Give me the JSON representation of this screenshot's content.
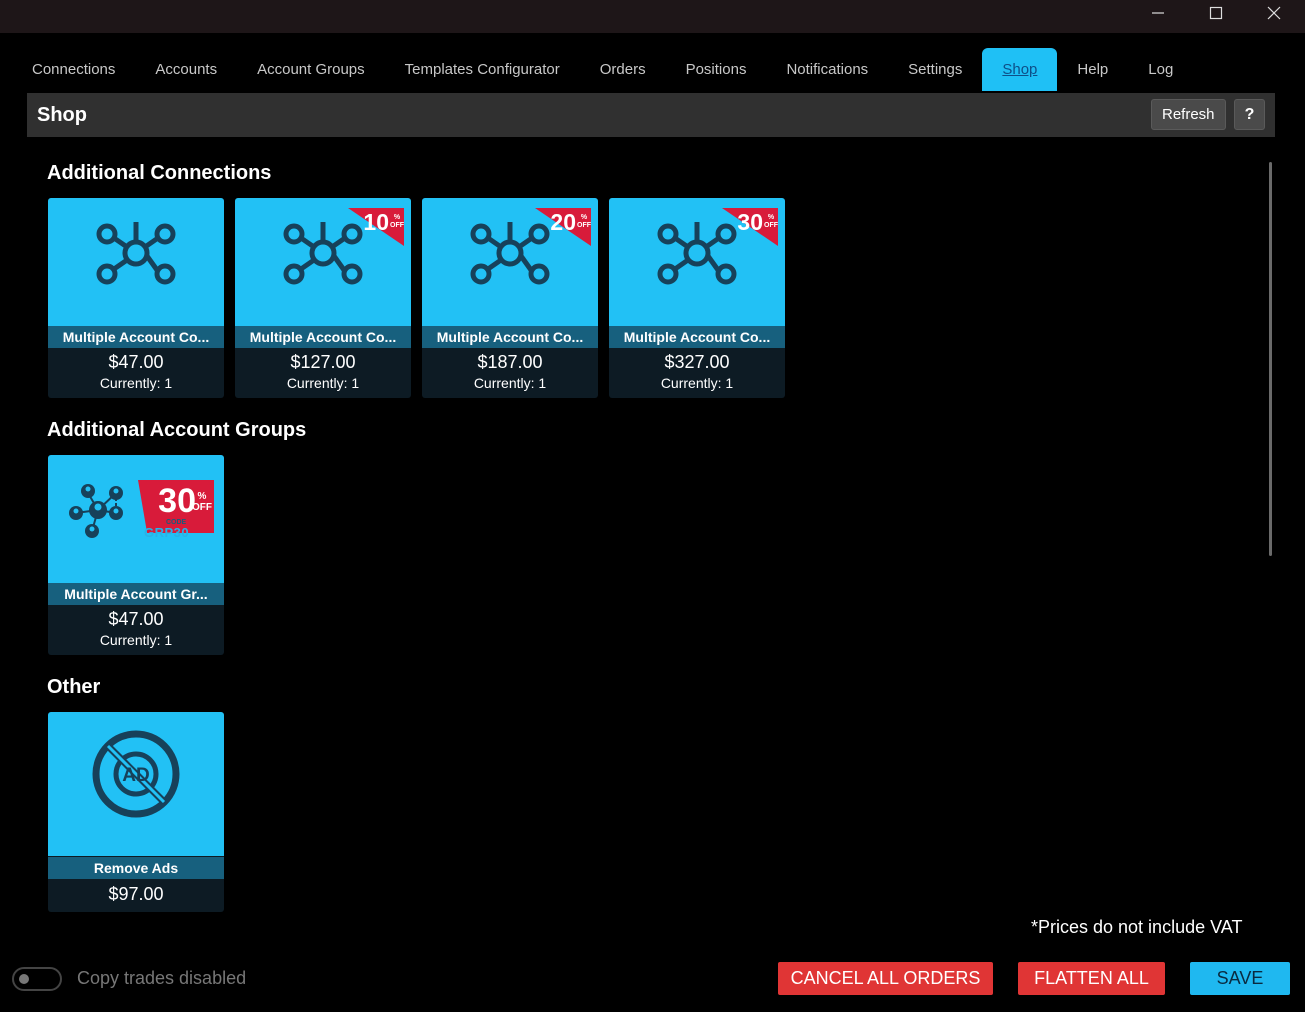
{
  "window": {
    "minimize_glyph": "—",
    "maximize_glyph": "☐",
    "close_glyph": "✕"
  },
  "tabs": [
    {
      "label": "Connections"
    },
    {
      "label": "Accounts"
    },
    {
      "label": "Account Groups"
    },
    {
      "label": "Templates Configurator"
    },
    {
      "label": "Orders"
    },
    {
      "label": "Positions"
    },
    {
      "label": "Notifications"
    },
    {
      "label": "Settings"
    },
    {
      "label": "Shop",
      "active": true
    },
    {
      "label": "Help"
    },
    {
      "label": "Log"
    }
  ],
  "header": {
    "title": "Shop",
    "refresh_label": "Refresh",
    "help_label": "?"
  },
  "sections": {
    "connections": {
      "title": "Additional Connections",
      "items": [
        {
          "name": "Multiple Account Co...",
          "price": "$47.00",
          "current": "Currently: 1",
          "icon": "network-icon"
        },
        {
          "name": "Multiple Account Co...",
          "price": "$127.00",
          "current": "Currently: 1",
          "icon": "network-icon",
          "discount": "10",
          "discount_unit": "%",
          "discount_off": "OFF"
        },
        {
          "name": "Multiple Account Co...",
          "price": "$187.00",
          "current": "Currently: 1",
          "icon": "network-icon",
          "discount": "20",
          "discount_unit": "%",
          "discount_off": "OFF"
        },
        {
          "name": "Multiple Account Co...",
          "price": "$327.00",
          "current": "Currently: 1",
          "icon": "network-icon",
          "discount": "30",
          "discount_unit": "%",
          "discount_off": "OFF"
        }
      ]
    },
    "groups": {
      "title": "Additional Account Groups",
      "items": [
        {
          "name": "Multiple Account Gr...",
          "price": "$47.00",
          "current": "Currently: 1",
          "icon": "user-group-network-icon",
          "discount": "30",
          "discount_unit": "%",
          "discount_off": "OFF",
          "code_label": "CODE",
          "code": "GRP30"
        }
      ]
    },
    "other": {
      "title": "Other",
      "items": [
        {
          "name": "Remove Ads",
          "price": "$97.00",
          "icon": "no-ads-icon",
          "icon_text": "AD"
        }
      ]
    }
  },
  "footer": {
    "vat_note": "*Prices do not include VAT",
    "copy_trades_label": "Copy trades disabled",
    "copy_trades_enabled": false,
    "cancel_all_label": "CANCEL ALL ORDERS",
    "flatten_all_label": "FLATTEN ALL",
    "save_label": "SAVE"
  },
  "colors": {
    "accent": "#1fc0f5",
    "danger": "#e03535",
    "card_name_bar": "#17607e",
    "badge_red": "#d81b3a"
  }
}
